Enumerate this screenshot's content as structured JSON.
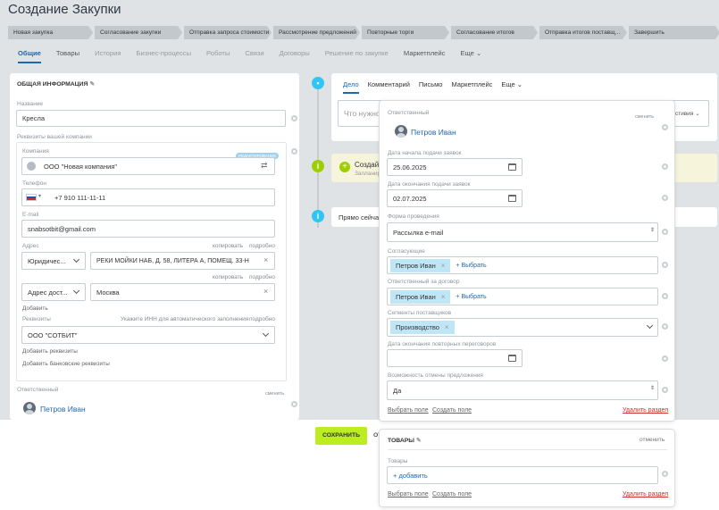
{
  "page": {
    "title": "Создание Закупки"
  },
  "stages": [
    "Новая закупка",
    "Согласование закупки",
    "Отправка запроса стоимости",
    "Рассмотрение предложений",
    "Повторные торги",
    "Согласование итогов",
    "Отправка итогов поставщ...",
    "Завершить"
  ],
  "tabs": [
    "Общие",
    "Товары",
    "История",
    "Бизнес-процессы",
    "Роботы",
    "Связи",
    "Договоры",
    "Решение по закупке",
    "Маркетплейс",
    "Еще"
  ],
  "general": {
    "section_title": "ОБЩАЯ ИНФОРМАЦИЯ",
    "name_label": "Название",
    "name_value": "Кресла",
    "company_requisites_label": "Реквизиты вашей компании",
    "company_label": "Компания",
    "company_value": "ООО \"Новая компания\"",
    "edit_badge": "РЕДАКТИРОВАНИЕ",
    "phone_label": "Телефон",
    "phone_value": "+7 910 111-11-11",
    "email_label": "E-mail",
    "email_value": "snabsotbit@gmail.com",
    "address_label": "Адрес",
    "copy_link": "копировать",
    "details_link": "подробно",
    "address1_type": "Юридичес...",
    "address1_value": "РЕКИ МОЙКИ НАБ, Д. 58, ЛИТЕРА А, ПОМЕЩ. 33-Н",
    "address2_type": "Адрес дост...",
    "address2_value": "Москва",
    "add_link": "Добавить",
    "requisites_label": "Реквизиты",
    "inn_hint": "Укажите ИНН для автоматического заполнения",
    "requisites_value": "ООО \"СОТБИТ\"",
    "add_requisites": "Добавить реквизиты",
    "add_bank_requisites": "Добавить банковские реквизиты",
    "responsible_label": "Ответственный",
    "change_link": "сменить",
    "responsible_value": "Петров Иван"
  },
  "timeline": {
    "tabs": [
      "Дело",
      "Комментарий",
      "Письмо",
      "Маркетплейс",
      "Еще"
    ],
    "input_placeholder": "Что нужно",
    "partial_status": "стивия",
    "item1_title": "Создайт",
    "item1_sub": "Запланир",
    "item2_title": "Прямо сейчас"
  },
  "popup": {
    "responsible_label": "Ответственный",
    "change_link": "сменить",
    "responsible_value": "Петров Иван",
    "start_label": "Дата начала подачи заявок",
    "start_value": "25.06.2025",
    "end_label": "Дата окончания подачи заявок",
    "end_value": "02.07.2025",
    "form_label": "Форма проведения",
    "form_value": "Рассылка e-mail",
    "approvers_label": "Согласующие",
    "approvers_tag": "Петров Иван",
    "select_link": "+ Выбрать",
    "contract_label": "Ответственный за договор",
    "contract_tag": "Петров Иван",
    "segments_label": "Сегменты поставщиков",
    "segments_tag": "Производство",
    "rebid_label": "Дата окончания повторных переговоров",
    "cancel_label": "Возможность отмены предложения",
    "cancel_value": "Да",
    "choose_field": "Выбрать поле",
    "create_field": "Создать поле",
    "delete_section": "Удалить раздел"
  },
  "goods": {
    "title": "ТОВАРЫ",
    "cancel": "отменить",
    "label": "Товары",
    "add": "+ добавить",
    "choose_field": "Выбрать поле",
    "create_field": "Создать поле",
    "delete_section": "Удалить раздел"
  },
  "footer": {
    "save": "СОХРАНИТЬ",
    "cancel_partial": "ОТ"
  },
  "colors": {
    "accent": "#2067b0",
    "save": "#bbed21",
    "delete": "#c8312d",
    "tag": "#bfe6f6",
    "timeline_blue": "#2fc6f6",
    "timeline_green": "#9dcf00"
  }
}
